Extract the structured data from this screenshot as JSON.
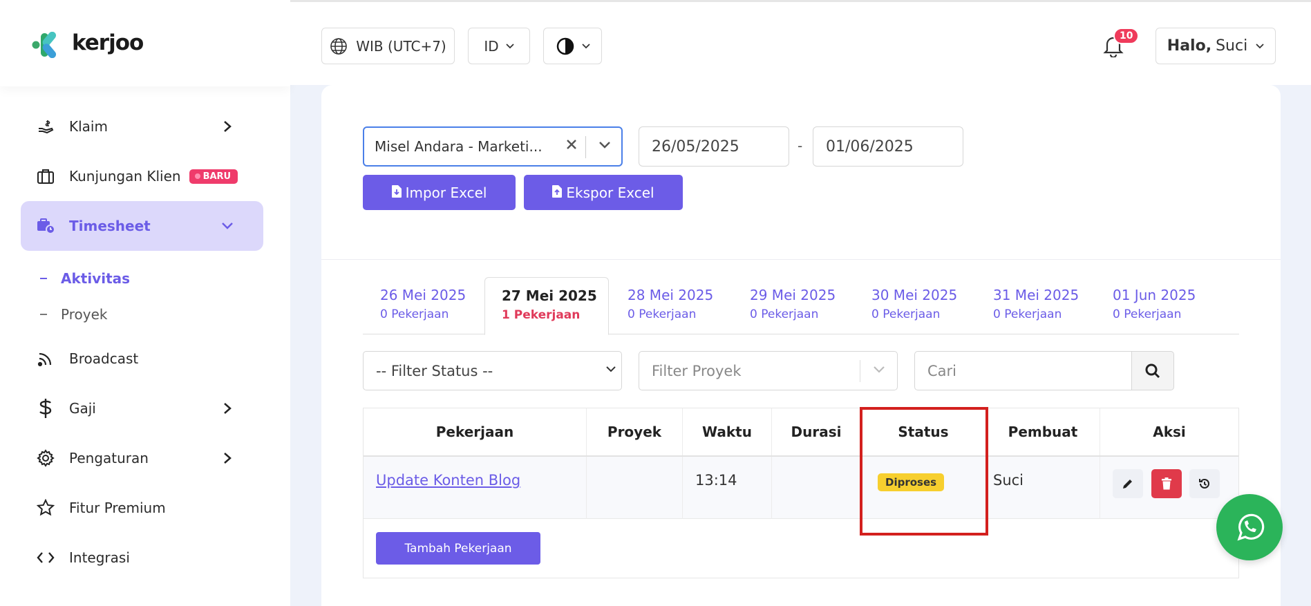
{
  "brand": {
    "name": "kerjoo"
  },
  "sidebar": {
    "items": [
      {
        "label": "Klaim",
        "icon": "hand-coin-icon"
      },
      {
        "label": "Kunjungan Klien",
        "icon": "briefcase-icon",
        "badge": "BARU"
      },
      {
        "label": "Timesheet",
        "icon": "timesheet-icon"
      },
      {
        "label": "Broadcast",
        "icon": "broadcast-icon"
      },
      {
        "label": "Gaji",
        "icon": "dollar-icon"
      },
      {
        "label": "Pengaturan",
        "icon": "gear-icon"
      },
      {
        "label": "Fitur Premium",
        "icon": "star-icon"
      },
      {
        "label": "Integrasi",
        "icon": "code-icon"
      }
    ],
    "sub_items": [
      {
        "label": "Aktivitas"
      },
      {
        "label": "Proyek"
      }
    ]
  },
  "header": {
    "timezone": "WIB (UTC+7)",
    "language": "ID",
    "notification_count": "10",
    "greeting_bold": "Halo,",
    "user_name": "Suci"
  },
  "filters_top": {
    "employee": "Misel Andara - Marketi...",
    "date_from": "26/05/2025",
    "date_sep": "-",
    "date_to": "01/06/2025",
    "import_label": "Impor Excel",
    "export_label": "Ekspor Excel"
  },
  "tabs": [
    {
      "date": "26 Mei 2025",
      "count": "0 Pekerjaan"
    },
    {
      "date": "27 Mei 2025",
      "count": "1 Pekerjaan"
    },
    {
      "date": "28 Mei 2025",
      "count": "0 Pekerjaan"
    },
    {
      "date": "29 Mei 2025",
      "count": "0 Pekerjaan"
    },
    {
      "date": "30 Mei 2025",
      "count": "0 Pekerjaan"
    },
    {
      "date": "31 Mei 2025",
      "count": "0 Pekerjaan"
    },
    {
      "date": "01 Jun 2025",
      "count": "0 Pekerjaan"
    }
  ],
  "filters": {
    "status": "-- Filter Status --",
    "project_placeholder": "Filter Proyek",
    "search_placeholder": "Cari"
  },
  "table": {
    "headers": [
      "Pekerjaan",
      "Proyek",
      "Waktu",
      "Durasi",
      "Status",
      "Pembuat",
      "Aksi"
    ],
    "rows": [
      {
        "job": "Update Konten Blog",
        "project": "",
        "time": "13:14",
        "duration": "",
        "status": "Diproses",
        "creator": "Suci"
      }
    ],
    "add_label": "Tambah Pekerjaan"
  },
  "colors": {
    "primary": "#6c5ce7",
    "active_bg": "#dcd8fb",
    "danger": "#e03a4a",
    "status_processing": "#f7cf2e",
    "whatsapp": "#2bb45a"
  }
}
